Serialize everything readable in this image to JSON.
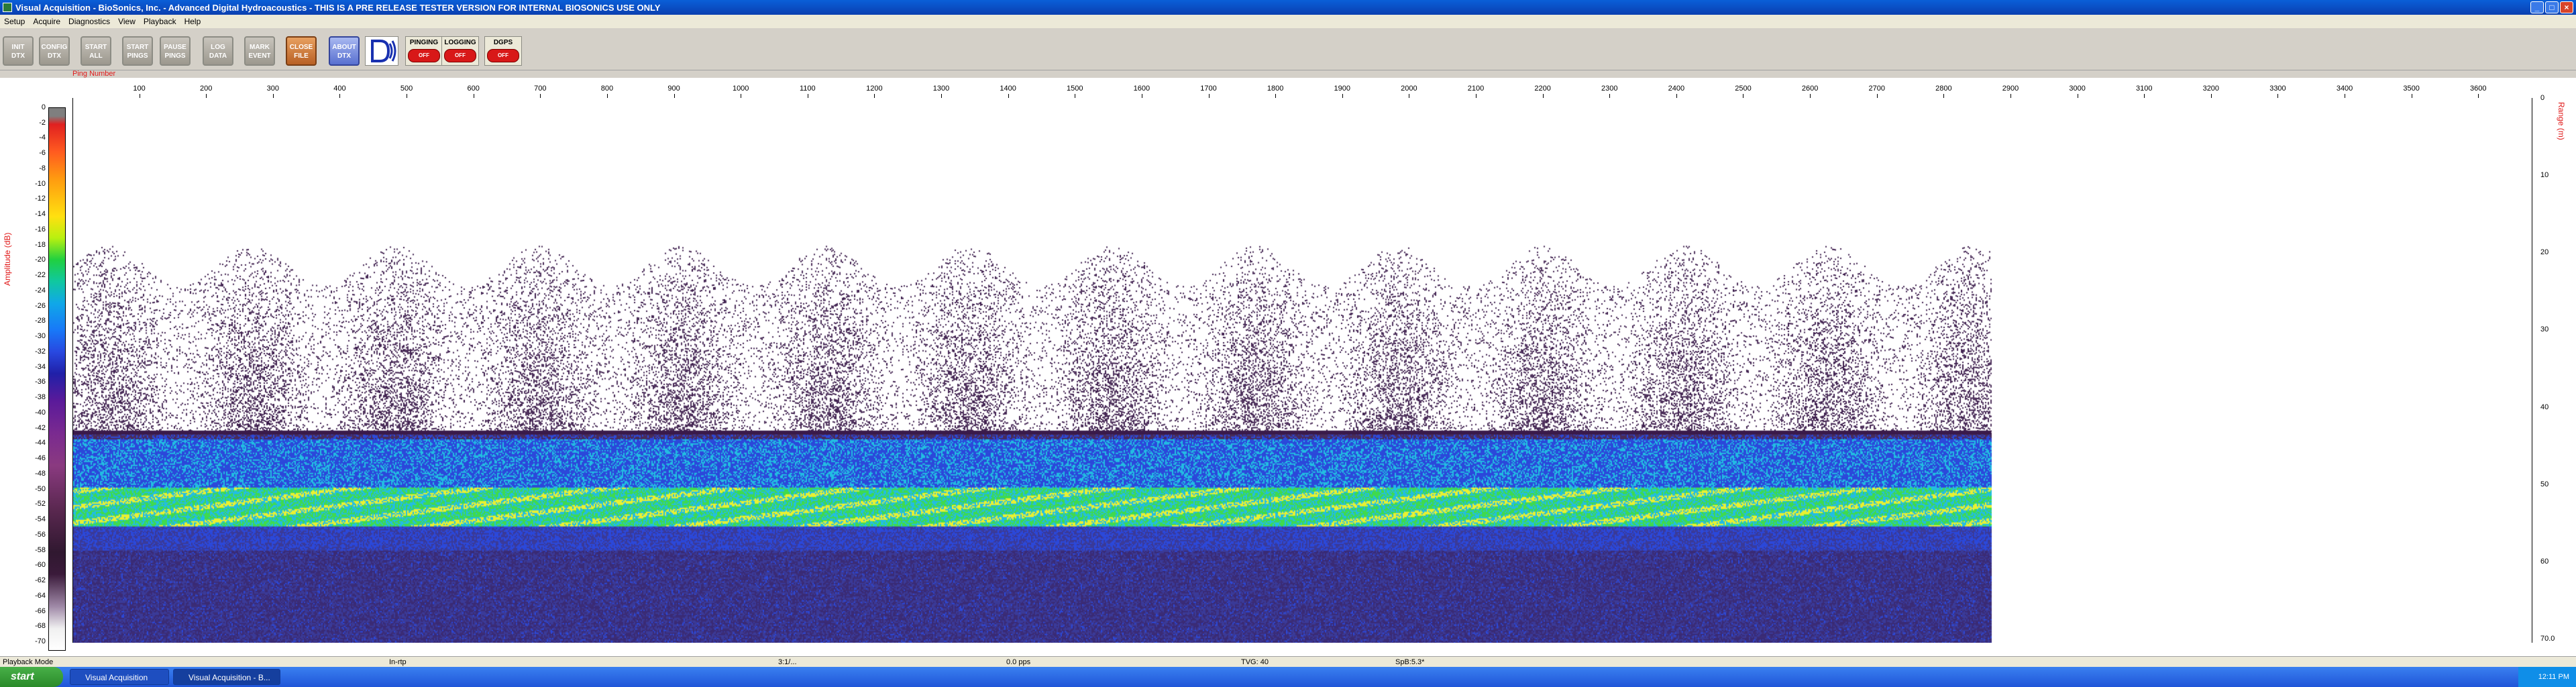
{
  "window": {
    "title": "Visual Acquisition  -  BioSonics, Inc.  -  Advanced Digital Hydroacoustics  -  THIS IS A PRE RELEASE TESTER VERSION FOR INTERNAL BIOSONICS USE ONLY",
    "minimize": "_",
    "maximize": "□",
    "close": "×"
  },
  "menu": [
    "Setup",
    "Acquire",
    "Diagnostics",
    "View",
    "Playback",
    "Help"
  ],
  "toolbar": {
    "buttons": [
      {
        "label1": "INIT",
        "label2": "DTX",
        "style": "gray"
      },
      {
        "label1": "CONFIG",
        "label2": "DTX",
        "style": "gray"
      },
      {
        "label1": "START",
        "label2": "ALL",
        "style": "gray"
      },
      {
        "label1": "START",
        "label2": "PINGS",
        "style": "gray"
      },
      {
        "label1": "PAUSE",
        "label2": "PINGS",
        "style": "gray"
      },
      {
        "label1": "LOG",
        "label2": "DATA",
        "style": "gray"
      },
      {
        "label1": "MARK",
        "label2": "EVENT",
        "style": "gray"
      },
      {
        "label1": "CLOSE",
        "label2": "FILE",
        "style": "orange"
      },
      {
        "label1": "ABOUT",
        "label2": "DTX",
        "style": "blue"
      }
    ],
    "indicators": [
      {
        "label": "PINGING",
        "state": "OFF"
      },
      {
        "label": "LOGGING",
        "state": "OFF"
      },
      {
        "label": "DGPS",
        "state": "OFF"
      }
    ]
  },
  "plot": {
    "ping_label": "Ping Number",
    "amplitude_label": "Amplitude (dB)",
    "range_label": "Range (m)",
    "x_ticks": [
      "100",
      "200",
      "300",
      "400",
      "500",
      "600",
      "700",
      "800",
      "900",
      "1000",
      "1100",
      "1200",
      "1300",
      "1400",
      "1500",
      "1600",
      "1700",
      "1800",
      "1900",
      "2000",
      "2100",
      "2200",
      "2300",
      "2400",
      "2500",
      "2600",
      "2700",
      "2800",
      "2900",
      "3000",
      "3100",
      "3200",
      "3300",
      "3400",
      "3500",
      "3600"
    ],
    "x_max": 3680,
    "data_end_ping": 2870,
    "amp_ticks": [
      "0",
      "-2",
      "-4",
      "-6",
      "-8",
      "-10",
      "-12",
      "-14",
      "-16",
      "-18",
      "-20",
      "-22",
      "-24",
      "-26",
      "-28",
      "-30",
      "-32",
      "-34",
      "-36",
      "-38",
      "-40",
      "-42",
      "-44",
      "-46",
      "-48",
      "-50",
      "-52",
      "-54",
      "-56",
      "-58",
      "-60",
      "-62",
      "-64",
      "-66",
      "-68",
      "-70"
    ],
    "range_ticks": [
      "0",
      "10",
      "20",
      "30",
      "40",
      "50",
      "60",
      "70.0"
    ],
    "range_max": 70,
    "layers": {
      "sparse_top": 19,
      "surface_top": 43,
      "bright_band_top": 50,
      "bright_band_bottom": 55,
      "dense_bottom": 58
    },
    "colors": {
      "white": "#ffffff",
      "purple": "#3a1a4a",
      "blue": "#1a3ad8",
      "cyan": "#10b8e0",
      "green": "#30d840",
      "yellow": "#e8f020",
      "deep": "#2a2a90"
    }
  },
  "status": {
    "mode": "Playback Mode",
    "file": "In-rtp",
    "ping": "3:1/...",
    "rate": "0.0 pps",
    "tvg": "TVG: 40",
    "spb": "SpB:5.3*"
  },
  "taskbar": {
    "start": "start",
    "items": [
      "Visual Acquisition",
      "Visual Acquisition - B..."
    ],
    "clock": "12:11 PM"
  }
}
